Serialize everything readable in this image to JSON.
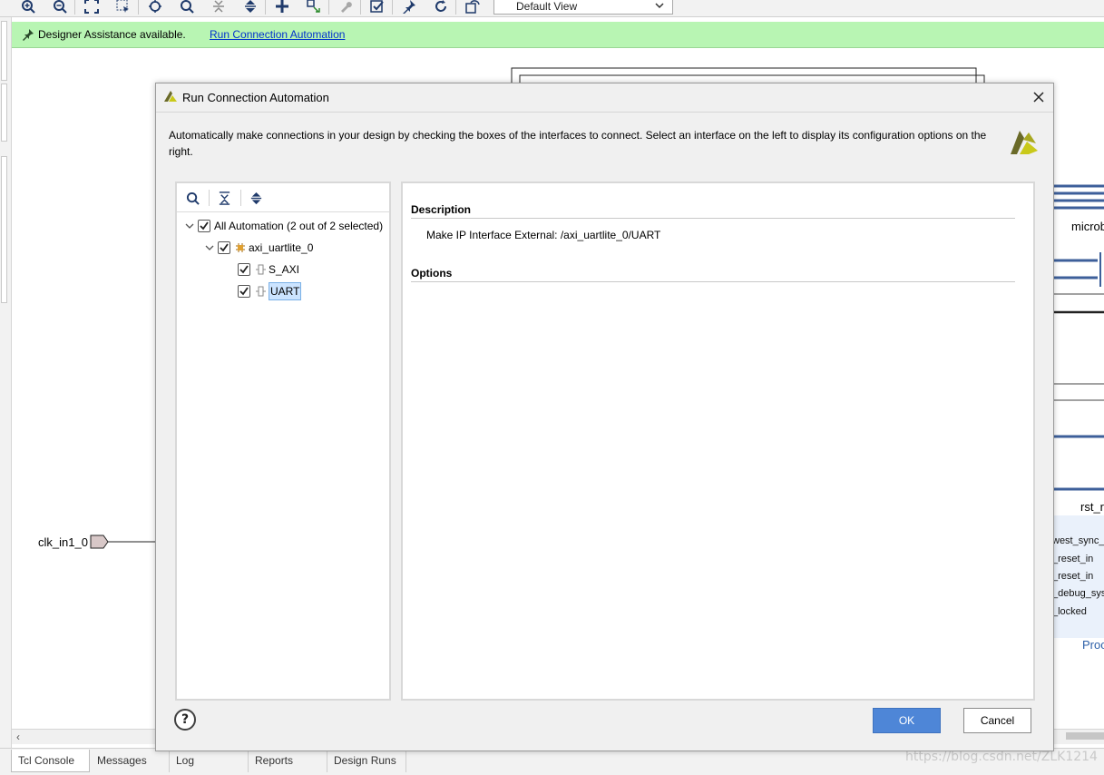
{
  "toolbar": {
    "icons": [
      "zoom-in",
      "zoom-out",
      "zoom-fit",
      "select-area",
      "zoom-target",
      "search",
      "collapse-all",
      "expand-all",
      "add",
      "auto-connect",
      "properties",
      "validate",
      "pin",
      "refresh",
      "regenerate"
    ],
    "view_select": "Default View"
  },
  "banner": {
    "text": "Designer Assistance available.",
    "link": "Run Connection Automation",
    "bg_color": "#b8f5b3"
  },
  "canvas": {
    "clk_port": "clk_in1_0",
    "block_microblaze_label": "microb",
    "block_reset_label": "rst_r",
    "reset_pins": [
      "west_sync_",
      "_reset_in",
      "_reset_in",
      "_debug_sys",
      "_locked"
    ],
    "proc_label": "Proc"
  },
  "dialog": {
    "title": "Run Connection Automation",
    "description": "Automatically make connections in your design by checking the boxes of the interfaces to connect. Select an interface on the left to display its configuration options on the right.",
    "tree": {
      "root": "All Automation (2 out of 2 selected)",
      "ip": "axi_uartlite_0",
      "interfaces": [
        "S_AXI",
        "UART"
      ]
    },
    "detail": {
      "description_heading": "Description",
      "description_text": "Make IP Interface External: /axi_uartlite_0/UART",
      "options_heading": "Options"
    },
    "help": "?",
    "ok": "OK",
    "cancel": "Cancel",
    "ok_color": "#4e86d7"
  },
  "bottom_tabs": [
    "Tcl Console",
    "Messages",
    "Log",
    "Reports",
    "Design Runs"
  ],
  "watermark": "https://blog.csdn.net/ZLK1214"
}
